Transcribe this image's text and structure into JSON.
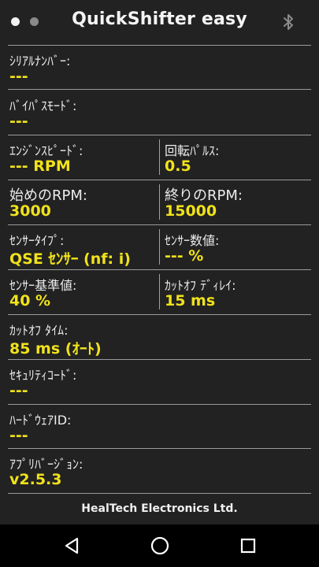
{
  "header": {
    "title": "QuickShifter easy",
    "bluetooth_icon": "bluetooth-icon"
  },
  "fields": {
    "serial": {
      "label": "ｼﾘｱﾙﾅﾝﾊﾞｰ:",
      "value": "---"
    },
    "bypass": {
      "label": "ﾊﾞｲﾊﾟｽﾓｰﾄﾞ:",
      "value": "---"
    },
    "engine_speed": {
      "label": "ｴﾝｼﾞﾝｽﾋﾟｰﾄﾞ:",
      "value": "--- RPM"
    },
    "pulses": {
      "label": "回転ﾊﾟﾙｽ:",
      "value": "0.5"
    },
    "start_rpm": {
      "label": "始めのRPM:",
      "value": "3000"
    },
    "end_rpm": {
      "label": "終りのRPM:",
      "value": "15000"
    },
    "sensor_type": {
      "label": "ｾﾝｻｰﾀｲﾌﾟ:",
      "value": "QSE ｾﾝｻｰ (nf: i)"
    },
    "sensor_value": {
      "label": "ｾﾝｻｰ数値:",
      "value": "--- %"
    },
    "sensor_ref": {
      "label": "ｾﾝｻｰ基準値:",
      "value": "40 %"
    },
    "cutoff_delay": {
      "label": "ｶｯﾄｵﾌ ﾃﾞｨﾚｲ:",
      "value": "15 ms"
    },
    "cutoff_time": {
      "label": "ｶｯﾄｵﾌ ﾀｲﾑ:",
      "value": "85 ms (ｵｰﾄ)"
    },
    "security_code": {
      "label": "ｾｷｭﾘﾃｨｺｰﾄﾞ:",
      "value": "---"
    },
    "hardware_id": {
      "label": "ﾊｰﾄﾞｳｪｱID:",
      "value": "---"
    },
    "app_version": {
      "label": "ｱﾌﾟﾘﾊﾞｰｼﾞｮﾝ:",
      "value": "v2.5.3"
    }
  },
  "footer": {
    "text": "HealTech Electronics Ltd."
  },
  "navbar": {
    "back_icon": "back-icon",
    "home_icon": "home-icon",
    "recents_icon": "recents-icon"
  },
  "colors": {
    "background": "#222222",
    "value": "#f0e21a",
    "divider": "#9a9a9a"
  }
}
